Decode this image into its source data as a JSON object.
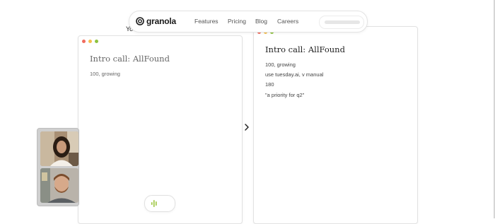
{
  "nav": {
    "logo_text": "granola",
    "links": [
      "Features",
      "Pricing",
      "Blog",
      "Careers"
    ]
  },
  "behind_text": "Yo",
  "left_note": {
    "title": "Intro call: AllFound",
    "lines": [
      "100, growing"
    ]
  },
  "right_note": {
    "title": "Intro call: AllFound",
    "lines": [
      "100, growing",
      "use tuesday.ai, v manual",
      "180",
      "\"a priority for q2\""
    ]
  },
  "colors": {
    "traffic_red": "#f06b5e",
    "traffic_yellow": "#f5be4f",
    "traffic_green": "#8ec23f",
    "accent_green": "#9bc53d"
  },
  "icons": {
    "logo": "granola-logo-icon",
    "arrow": "chevron-right-icon",
    "recording": "audio-wave-icon"
  }
}
